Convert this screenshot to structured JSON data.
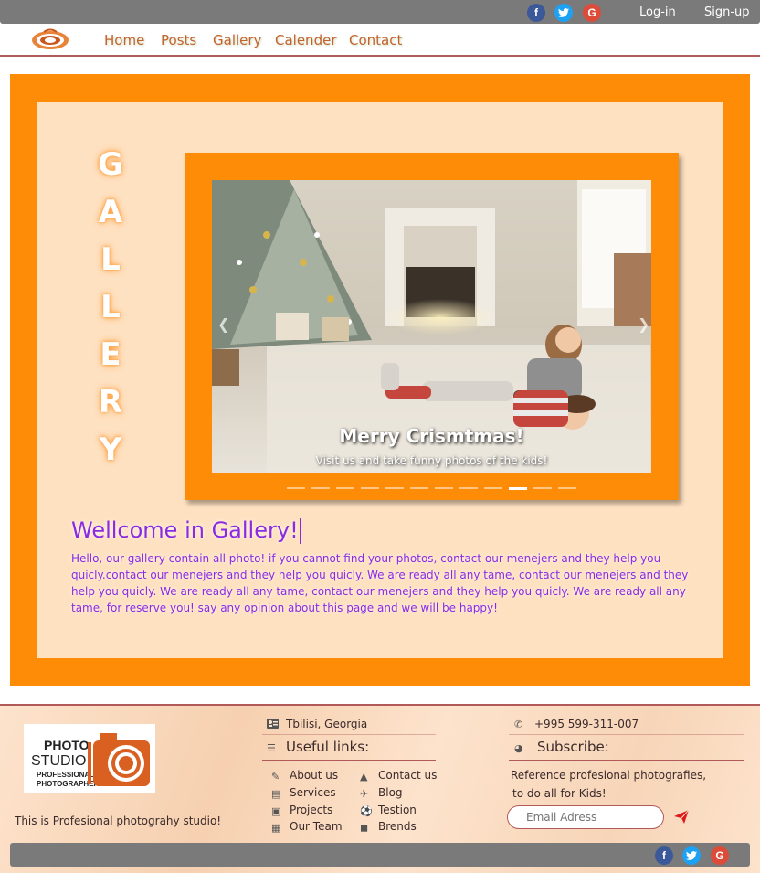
{
  "topbar": {
    "social": [
      "facebook-icon",
      "twitter-icon",
      "google-icon"
    ],
    "login": "Log-in",
    "signup": "Sign-up"
  },
  "nav": {
    "items": [
      "Home",
      "Posts",
      "Gallery",
      "Calender",
      "Contact"
    ]
  },
  "gallery": {
    "letters": [
      "G",
      "A",
      "L",
      "L",
      "E",
      "R",
      "Y"
    ],
    "slide_title": "Merry Crismtmas!",
    "slide_subtitle": "Visit us and take funny photos of the kids!",
    "slide_count": 12,
    "active_slide": 10
  },
  "welcome": {
    "title": "Wellcome in Gallery!",
    "paragraph": "Hello, our gallery contain all photo! if you cannot find your photos, contact our menejers and they help you quicly.contact our menejers and they help you quicly. We are ready all any tame, contact our menejers and they help you quicly. We are ready all any tame, contact our menejers and they help you quicly. We are ready all any tame, for reserve you! say any opinion about this page and we will be happy!"
  },
  "footer": {
    "logo_text": [
      "PHOTO",
      "STUDIO",
      "PROFESSIONAL",
      "PHOTOGRAPHER"
    ],
    "tagline": "This is Profesional photograhy studio!",
    "address": "Tbilisi, Georgia",
    "useful_links_title": "Useful links:",
    "links_col1": [
      "About us",
      "Services",
      "Projects",
      "Our Team"
    ],
    "links_col2": [
      "Contact us",
      "Blog",
      "Testion",
      "Brends"
    ],
    "phone": "+995 599-311-007",
    "subscribe_title": "Subscribe:",
    "subscribe_text_1": "Reference profesional photografies,",
    "subscribe_text_2": "to do all for Kids!",
    "email_placeholder": "Email Adress"
  },
  "colors": {
    "orange": "#ff8c06",
    "cream": "#fee1c1",
    "purple": "#8a2be2",
    "nav_link": "#c4622f",
    "gray_bar": "#7a7a7a"
  }
}
